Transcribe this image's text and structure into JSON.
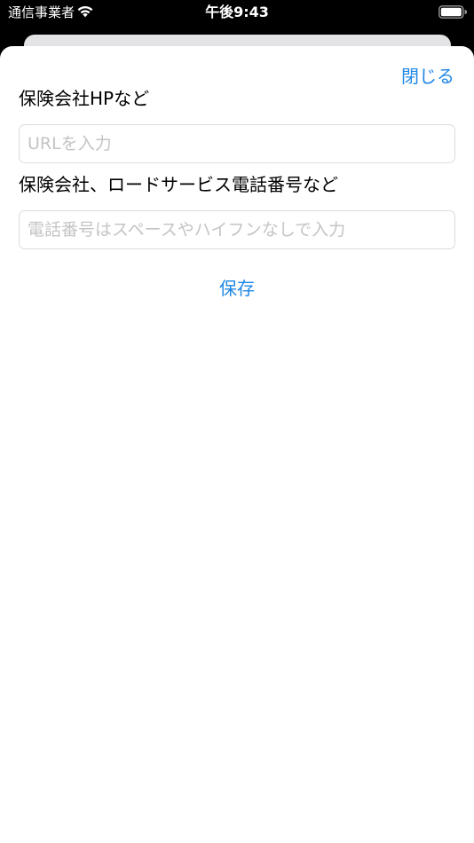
{
  "status_bar": {
    "carrier": "通信事業者",
    "time": "午後9:43",
    "wifi_icon": "wifi-icon",
    "battery_icon": "battery-icon"
  },
  "sheet": {
    "close_label": "閉じる",
    "hp_section_label": "保険会社HPなど",
    "url_field": {
      "value": "",
      "placeholder": "URLを入力"
    },
    "phone_section_label": "保険会社、ロードサービス電話番号など",
    "phone_field": {
      "value": "",
      "placeholder": "電話番号はスペースやハイフンなしで入力"
    },
    "save_label": "保存"
  },
  "colors": {
    "accent": "#1e87e6",
    "placeholder": "#c4c4c7",
    "field_border": "#dcdcde",
    "background": "#000000",
    "sheet": "#ffffff"
  }
}
